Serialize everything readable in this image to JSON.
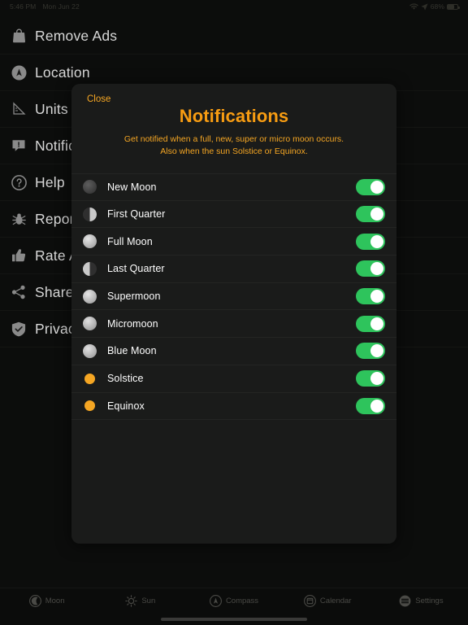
{
  "statusbar": {
    "time": "5:46 PM",
    "date": "Mon Jun 22",
    "battery_percent": "68%",
    "wifi_icon": "wifi-icon",
    "location_icon": "location-arrow-icon",
    "battery_icon": "battery-icon"
  },
  "sidebar": {
    "items": [
      {
        "label": "Remove Ads",
        "icon": "shopping-bag-icon"
      },
      {
        "label": "Location",
        "icon": "location-circle-icon"
      },
      {
        "label": "Units of",
        "icon": "ruler-icon"
      },
      {
        "label": "Notifications",
        "icon": "alert-bubble-icon"
      },
      {
        "label": "Help",
        "icon": "question-circle-icon"
      },
      {
        "label": "Report",
        "icon": "bug-icon"
      },
      {
        "label": "Rate App",
        "icon": "thumbs-up-icon"
      },
      {
        "label": "Share App",
        "icon": "share-icon"
      },
      {
        "label": "Privacy",
        "icon": "shield-check-icon"
      }
    ]
  },
  "modal": {
    "close_label": "Close",
    "title": "Notifications",
    "subtitle": "Get notified when a full, new, super or micro moon occurs. Also when the sun Solstice or Equinox.",
    "accent_color": "#f79c12",
    "toggle_on_color": "#2ec45c",
    "rows": [
      {
        "label": "New Moon",
        "icon": "moon-new-icon",
        "phase": "new",
        "toggle": "on"
      },
      {
        "label": "First Quarter",
        "icon": "moon-first-quarter-icon",
        "phase": "first-quarter",
        "toggle": "on"
      },
      {
        "label": "Full Moon",
        "icon": "moon-full-icon",
        "phase": "full",
        "toggle": "on"
      },
      {
        "label": "Last Quarter",
        "icon": "moon-last-quarter-icon",
        "phase": "last-quarter",
        "toggle": "on"
      },
      {
        "label": "Supermoon",
        "icon": "moon-super-icon",
        "phase": "full",
        "toggle": "on"
      },
      {
        "label": "Micromoon",
        "icon": "moon-micro-icon",
        "phase": "full",
        "toggle": "on"
      },
      {
        "label": "Blue Moon",
        "icon": "moon-blue-icon",
        "phase": "full",
        "toggle": "on"
      },
      {
        "label": "Solstice",
        "icon": "sun-dot-icon",
        "phase": "sun",
        "toggle": "on"
      },
      {
        "label": "Equinox",
        "icon": "sun-dot-icon",
        "phase": "sun",
        "toggle": "on"
      }
    ]
  },
  "tabbar": {
    "tabs": [
      {
        "label": "Moon",
        "icon": "moon-crescent-icon"
      },
      {
        "label": "Sun",
        "icon": "sun-icon"
      },
      {
        "label": "Compass",
        "icon": "compass-icon"
      },
      {
        "label": "Calendar",
        "icon": "calendar-icon"
      },
      {
        "label": "Settings",
        "icon": "settings-lines-icon"
      }
    ]
  }
}
